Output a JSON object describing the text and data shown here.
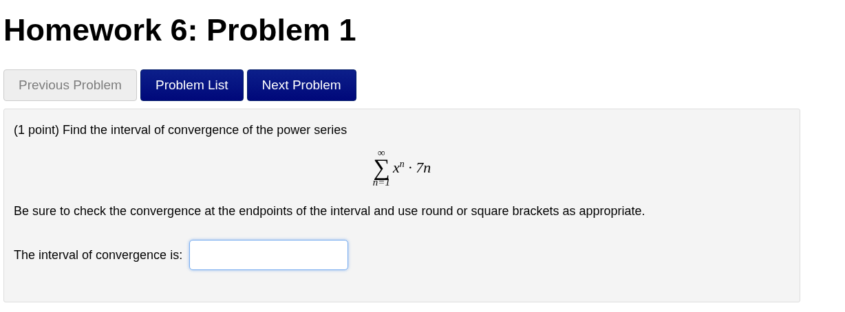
{
  "title": "Homework 6: Problem 1",
  "nav_buttons": [
    {
      "label": "Previous Problem",
      "disabled": true
    },
    {
      "label": "Problem List",
      "disabled": false
    },
    {
      "label": "Next Problem",
      "disabled": false
    }
  ],
  "problem": {
    "intro": "(1 point) Find the interval of convergence of the power series",
    "formula": {
      "operator": "∑",
      "upper": "∞",
      "lower": "n=1",
      "term": "x$^{n}$ · 7n"
    },
    "instructions": "Be sure to check the convergence at the endpoints of the interval and use round or square brackets as appropriate.",
    "answer": {
      "label": "The interval of convergence is:",
      "focused": true
    }
  }
}
